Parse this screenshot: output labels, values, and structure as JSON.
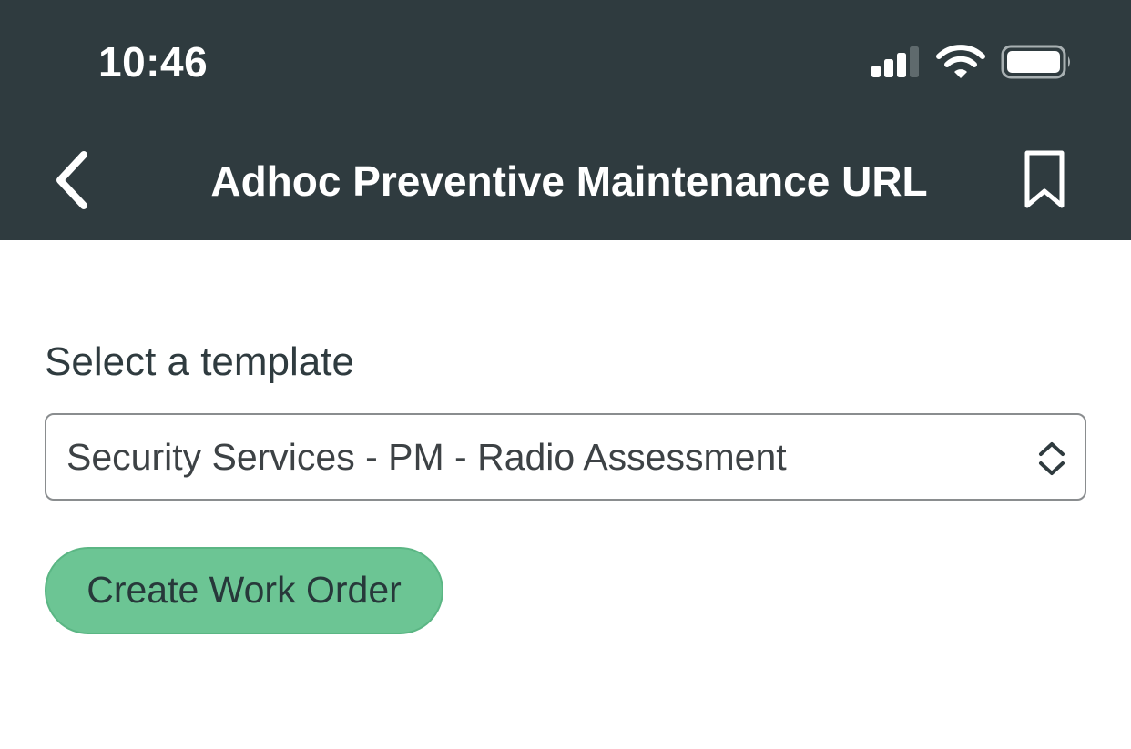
{
  "status_bar": {
    "time": "10:46",
    "icons": [
      "signal-icon",
      "wifi-icon",
      "battery-icon"
    ]
  },
  "nav_bar": {
    "title": "Adhoc Preventive Maintenance URL",
    "left_icon": "back-icon",
    "right_icon": "bookmark-icon",
    "background_color": "#2f3b3f"
  },
  "form": {
    "label": "Select a template",
    "selected_template": "Security Services - PM - Radio Assessment",
    "select_icon": "chevron-up-down-icon",
    "submit_label": "Create Work Order",
    "submit_color": "#6cc594"
  }
}
